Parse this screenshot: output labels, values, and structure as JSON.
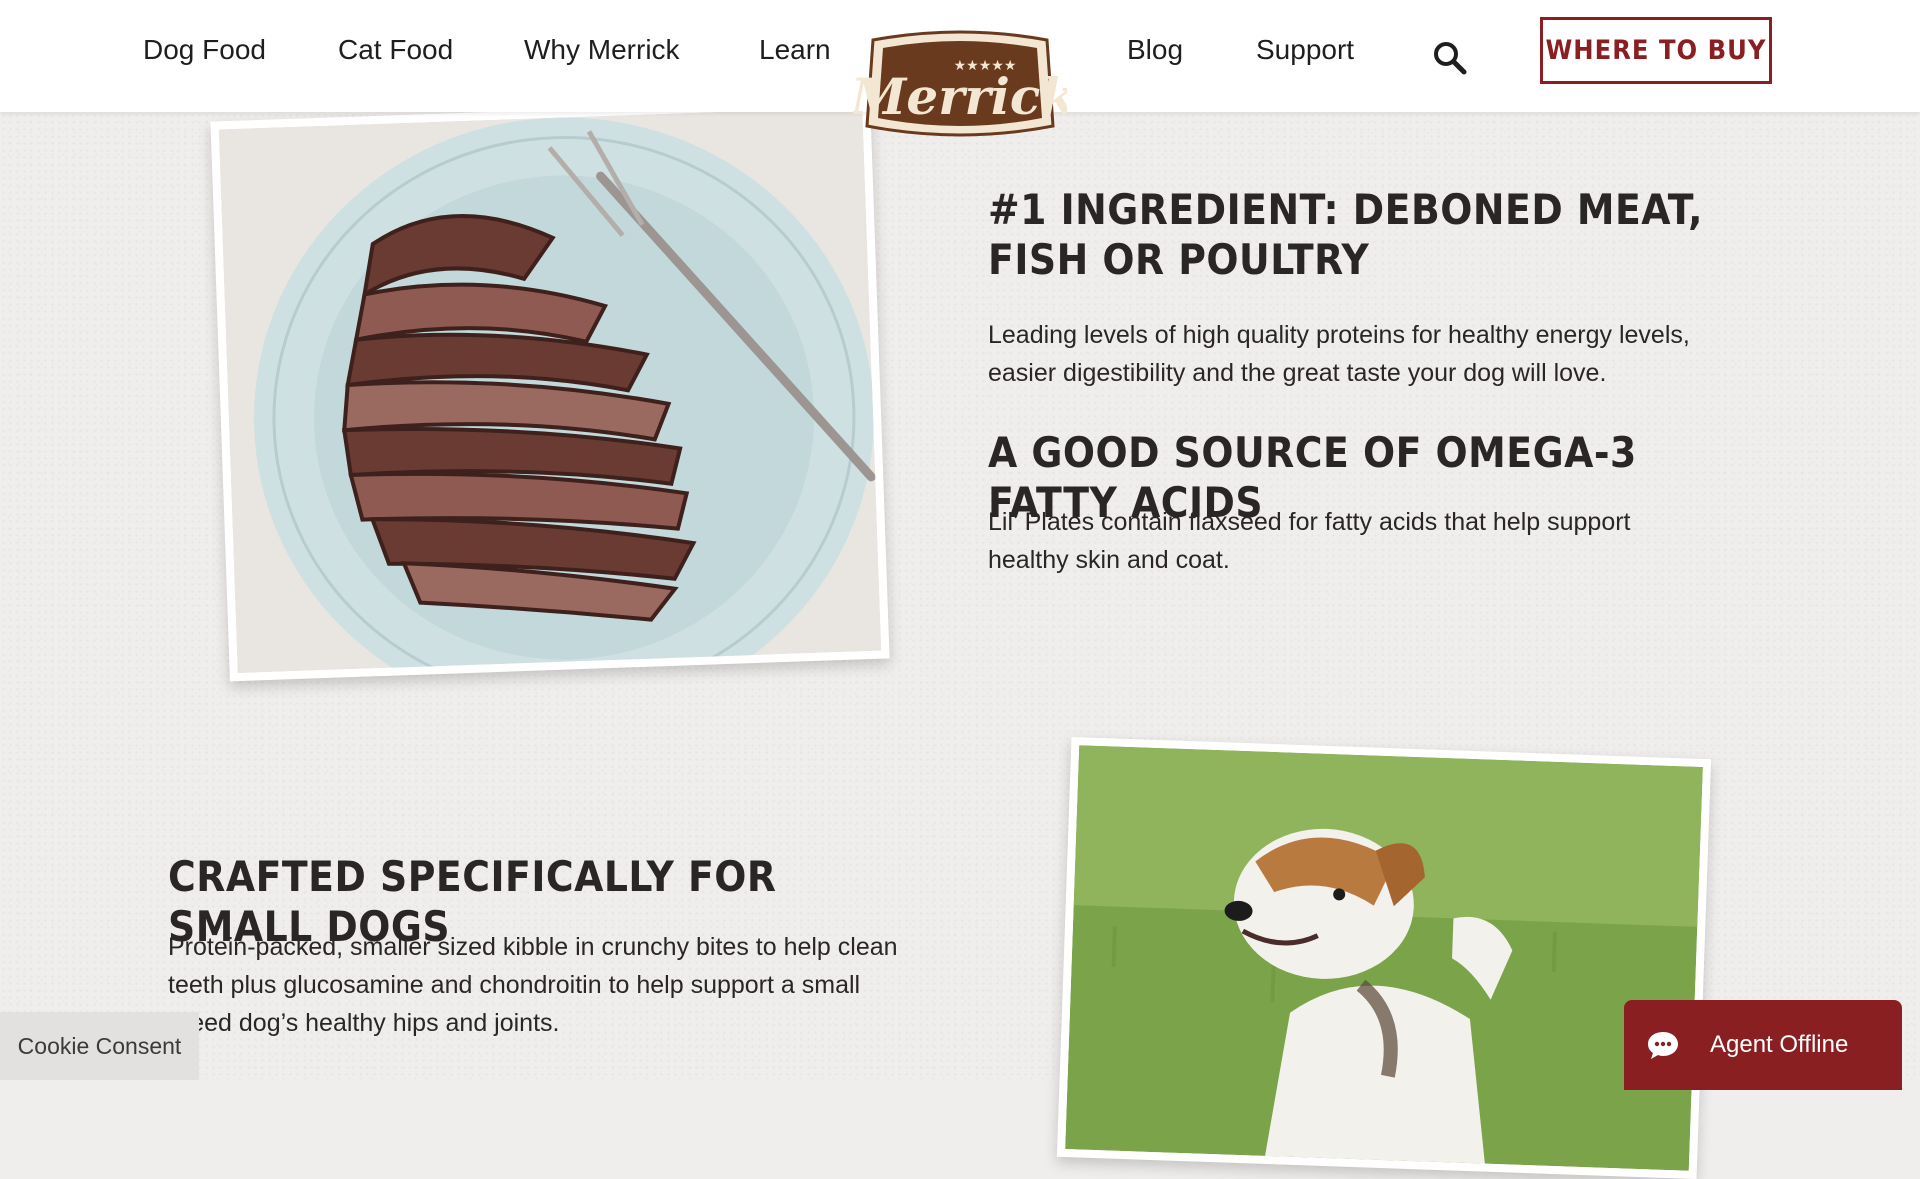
{
  "nav": {
    "links": [
      "Dog Food",
      "Cat Food",
      "Why Merrick",
      "Learn",
      "Blog",
      "Support"
    ],
    "search_icon": "search-icon",
    "where_to_buy": "WHERE TO BUY",
    "logo_text": "Merrick",
    "logo_stars": "★★★★★"
  },
  "sections": {
    "ingredient_heading": "#1 Ingredient: Deboned Meat, Fish or Poultry",
    "ingredient_text": "Leading levels of high quality proteins for healthy energy levels, easier digestibility and the great taste your dog will love.",
    "omega_heading": "A Good Source of Omega-3 Fatty Acids",
    "omega_text": "Lil’ Plates contain flaxseed for fatty acids that help support healthy skin and coat.",
    "crafted_heading": "Crafted Specifically for Small Dogs",
    "crafted_text": "Protein-packed, smaller sized kibble in crunchy bites to help clean teeth plus glucosamine and chondroitin to help support a small breed dog’s healthy hips and joints."
  },
  "widgets": {
    "cookie_consent": "Cookie Consent",
    "agent_status": "Agent Offline",
    "chat_icon": "chat-bubble-icon"
  },
  "colors": {
    "brand_red": "#8a1f22",
    "logo_brown": "#6a3a1e",
    "page_bg": "#f0eeec"
  }
}
